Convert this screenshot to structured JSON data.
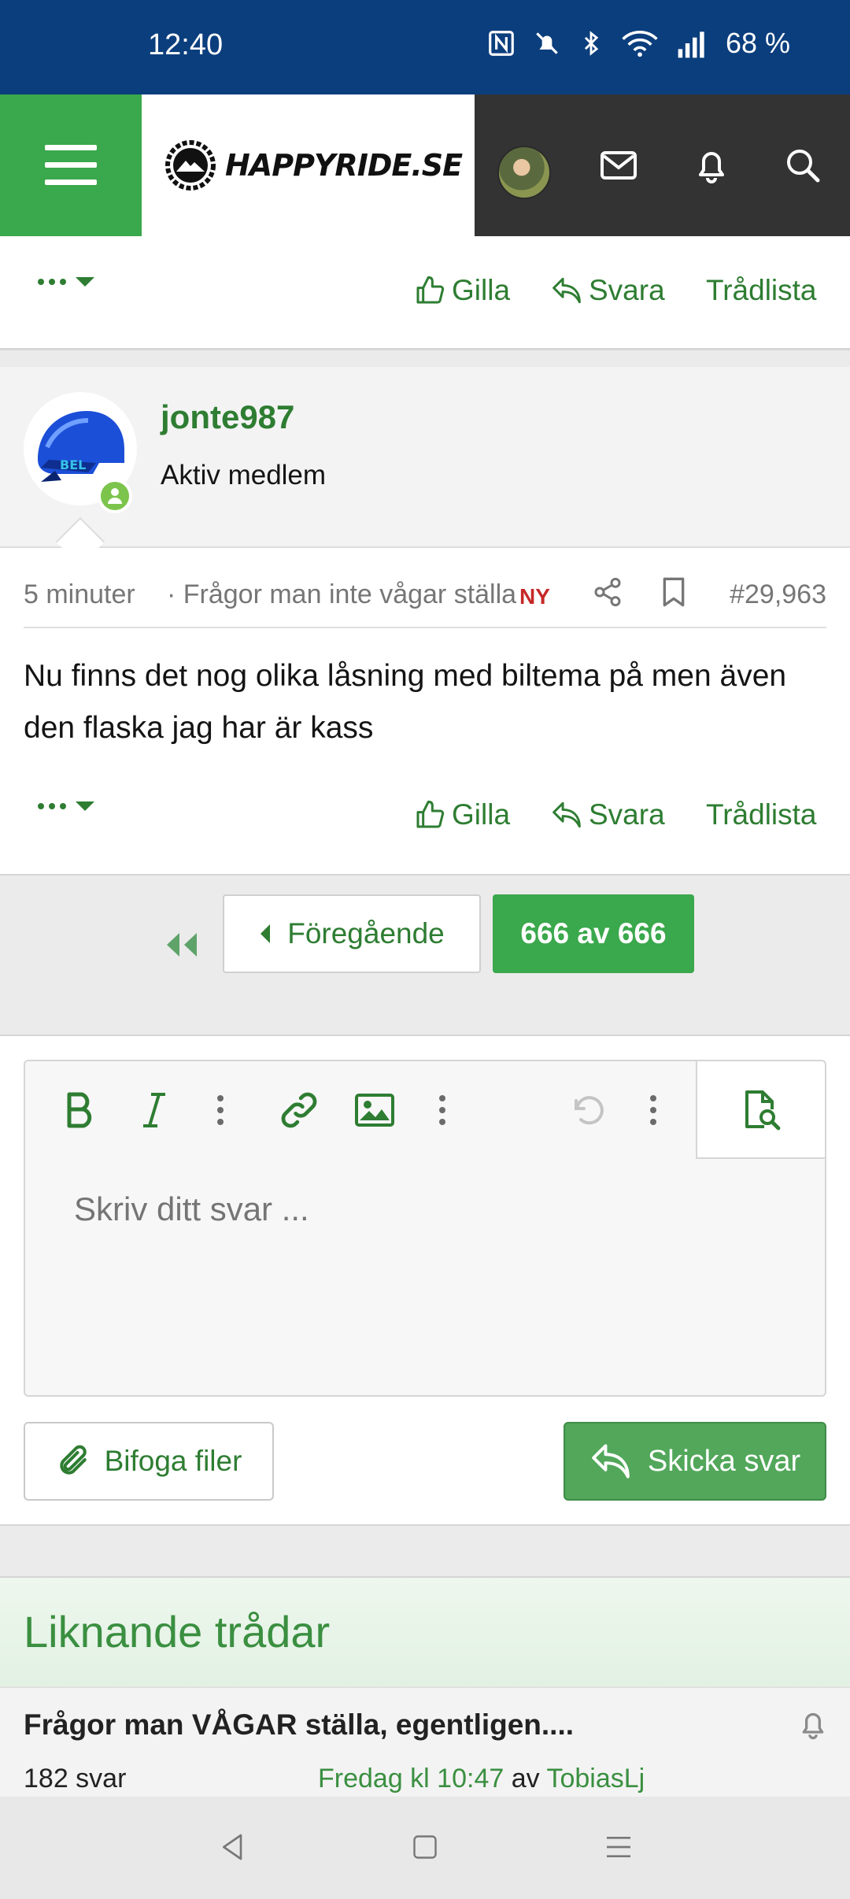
{
  "status_bar": {
    "time": "12:40",
    "battery": "68 %",
    "icons": [
      "nfc-icon",
      "silent-icon",
      "bluetooth-icon",
      "wifi-icon",
      "signal-icon"
    ]
  },
  "header": {
    "logo_text": "HAPPYRIDE.SE",
    "icons": [
      "menu-icon",
      "avatar",
      "mail-icon",
      "bell-icon",
      "search-icon"
    ],
    "accent": "#3aa84c",
    "dark": "#333333"
  },
  "post_actions": {
    "like": "Gilla",
    "reply": "Svara",
    "thread_list": "Trådlista"
  },
  "post": {
    "username": "jonte987",
    "user_title": "Aktiv medlem",
    "time": "5 minuter",
    "thread": "· Frågor man inte vågar ställa",
    "new_badge": "NY",
    "number": "#29,963",
    "body": "Nu finns det nog olika låsning med biltema på men även den flaska jag har är kass"
  },
  "pagination": {
    "prev": "Föregående",
    "current": "666 av 666"
  },
  "editor": {
    "placeholder": "Skriv ditt svar ...",
    "tools": [
      "bold-icon",
      "italic-icon",
      "more-icon",
      "link-icon",
      "image-icon",
      "more-icon",
      "undo-icon",
      "more-icon",
      "preview-icon"
    ]
  },
  "buttons": {
    "attach": "Bifoga filer",
    "submit": "Skicka svar"
  },
  "similar": {
    "heading": "Liknande trådar",
    "items": [
      {
        "title": "Frågor man VÅGAR ställa, egentligen....",
        "replies": "182 svar",
        "last_time": "Fredag kl 10:47",
        "by": "av",
        "last_user": "TobiasLj"
      }
    ]
  }
}
